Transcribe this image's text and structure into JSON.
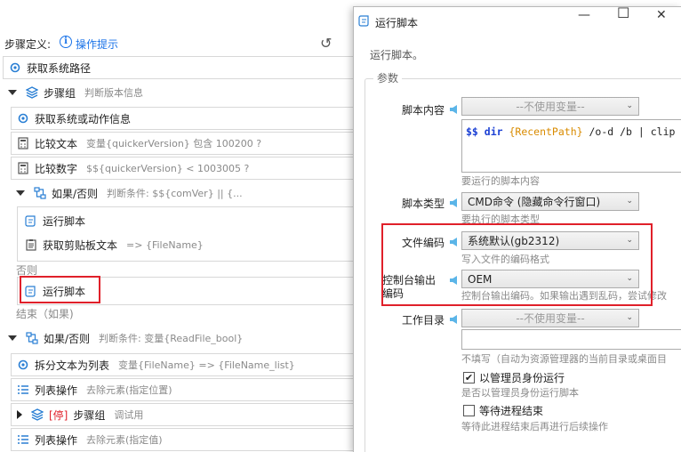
{
  "toolbar": {
    "steps_label": "步骤定义:",
    "help_link": "操作提示"
  },
  "steps": {
    "s1": {
      "title": "获取系统路径",
      "sub": ""
    },
    "s2": {
      "title": "步骤组",
      "sub": "判断版本信息"
    },
    "s3": {
      "title": "获取系统或动作信息",
      "sub": ""
    },
    "s4": {
      "title": "比较文本",
      "sub": "变量{quickerVersion} 包含  100200 ?"
    },
    "s5": {
      "title": "比较数字",
      "sub": "$${quickerVersion} <  1003005 ?"
    },
    "s6": {
      "title": "如果/否则",
      "sub": "判断条件: $${comVer} || {..."
    },
    "s7": {
      "title": "运行脚本",
      "sub": ""
    },
    "s8": {
      "title": "获取剪贴板文本",
      "sub": "=> {FileName}"
    },
    "else_label": "否则",
    "s9": {
      "title": "运行脚本",
      "sub": ""
    },
    "end_label": "结束（如果)",
    "s10": {
      "title": "如果/否则",
      "sub": "判断条件: 变量{ReadFile_bool}"
    },
    "s11": {
      "title": "拆分文本为列表",
      "sub": "变量{FileName} => {FileName_list}"
    },
    "s12": {
      "title": "列表操作",
      "sub": "去除元素(指定位置)"
    },
    "s13": {
      "prefix": "[停]",
      "title": "步骤组",
      "sub": "调试用"
    },
    "s14": {
      "title": "列表操作",
      "sub": "去除元素(指定值)"
    }
  },
  "dialog": {
    "title": "运行脚本",
    "description": "运行脚本。",
    "group_label": "参数",
    "script_content": {
      "label": "脚本内容",
      "var_select": "--不使用变量--",
      "code": {
        "prefix": "$$ dir ",
        "var": "{RecentPath}",
        "suffix": " /o-d /b | clip"
      },
      "hint": "要运行的脚本内容"
    },
    "script_type": {
      "label": "脚本类型",
      "value": "CMD命令 (隐藏命令行窗口)",
      "hint": "要执行的脚本类型"
    },
    "file_encoding": {
      "label": "文件编码",
      "value": "系统默认(gb2312)",
      "hint": "写入文件的编码格式"
    },
    "console_encoding": {
      "label_line1": "控制台输出",
      "label_line2": "编码",
      "value": "OEM",
      "hint": "控制台输出编码。如果输出遇到乱码，尝试修改"
    },
    "work_dir": {
      "label": "工作目录",
      "var_select": "--不使用变量--",
      "value": "",
      "hint": "不填写（自动为资源管理器的当前目录或桌面目"
    },
    "run_as_admin": {
      "label": "以管理员身份运行",
      "checked": "✔",
      "hint": "是否以管理员身份运行脚本"
    },
    "wait_exit": {
      "label": "等待进程结束",
      "checked": "",
      "hint": "等待此进程结束后再进行后续操作"
    }
  },
  "colors": {
    "accent": "#1a73e8",
    "highlight": "#e0202a",
    "arrow": "#5bb5e8",
    "code_var": "#d98b00"
  }
}
